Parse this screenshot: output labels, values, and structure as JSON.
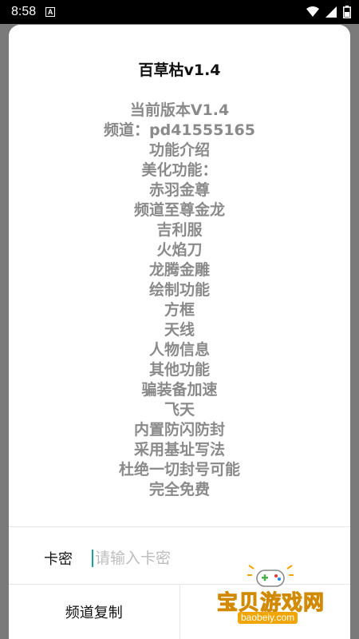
{
  "status_bar": {
    "time": "8:58",
    "notification_icon": "a-box-icon",
    "wifi_icon": "wifi-icon",
    "signal_icon": "signal-icon",
    "battery_icon": "battery-icon"
  },
  "dialog": {
    "title": "百草枯v1.4",
    "content_lines": [
      "当前版本V1.4",
      "频道：pd41555165",
      "功能介绍",
      "美化功能：",
      "赤羽金尊",
      "频道至尊金龙",
      "吉利服",
      "火焰刀",
      "龙腾金雕",
      "绘制功能",
      "方框",
      "天线",
      "人物信息",
      "其他功能",
      "骗装备加速",
      "飞天",
      "内置防闪防封",
      "采用基址写法",
      "杜绝一切封号可能",
      "完全免费"
    ],
    "key_label": "卡密",
    "key_input_placeholder": "请输入卡密",
    "key_input_value": "",
    "copy_channel_button": "频道复制"
  },
  "watermark": {
    "text": "宝贝游戏网",
    "url": "baobeiy.com",
    "icon": "gamepad-icon",
    "colors": {
      "main": "#f5b700",
      "accent": "#f0a500"
    }
  },
  "colors": {
    "accent_cursor": "#1aa39a",
    "content_text": "#8a8a8a",
    "overlay": "#7a7a7a"
  }
}
